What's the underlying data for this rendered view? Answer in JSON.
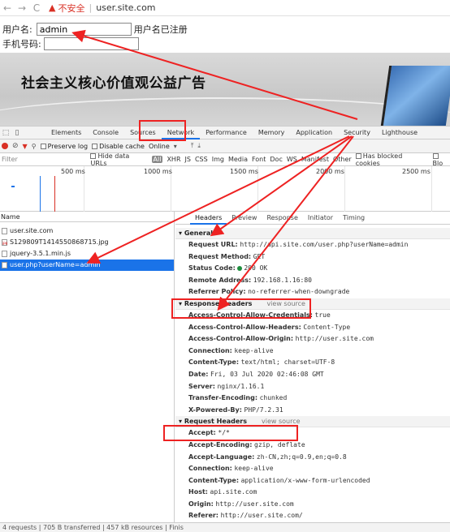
{
  "browser": {
    "back": "←",
    "forward": "→",
    "reload": "C",
    "insecure_label": "不安全",
    "separator": "|",
    "url": "user.site.com"
  },
  "form": {
    "username_label": "用户名:",
    "username_value": "admin",
    "username_status": "用户名已注册",
    "phone_label": "手机号码:",
    "phone_value": ""
  },
  "banner": {
    "text": "社会主义核心价值观公益广告"
  },
  "devtools": {
    "tabs": [
      "Elements",
      "Console",
      "Sources",
      "Network",
      "Performance",
      "Memory",
      "Application",
      "Security",
      "Lighthouse"
    ],
    "toolbar": {
      "preserve_log": "Preserve log",
      "disable_cache": "Disable cache",
      "throttle": "Online"
    },
    "filter": {
      "placeholder": "Filter",
      "hide_data_urls": "Hide data URLs",
      "types": [
        "All",
        "XHR",
        "JS",
        "CSS",
        "Img",
        "Media",
        "Font",
        "Doc",
        "WS",
        "Manifest",
        "Other"
      ],
      "has_blocked": "Has blocked cookies",
      "blocked_requests": "Blo"
    },
    "timeline_ticks": [
      "500 ms",
      "1000 ms",
      "1500 ms",
      "2000 ms",
      "2500 ms"
    ],
    "requests": {
      "header": "Name",
      "items": [
        "user.site.com",
        "S129809T1414550868715.jpg",
        "jquery-3.5.1.min.js",
        "user.php?userName=admin"
      ],
      "selected": "user.php?userName=admin"
    },
    "status_bar": "4 requests | 705 B transferred | 457 kB resources | Finis",
    "detail": {
      "tabs": [
        "Headers",
        "Preview",
        "Response",
        "Initiator",
        "Timing"
      ],
      "general": {
        "title": "General",
        "rows": [
          {
            "k": "Request URL:",
            "v": "http://api.site.com/user.php?userName=admin"
          },
          {
            "k": "Request Method:",
            "v": "GET"
          },
          {
            "k": "Status Code:",
            "v": "200 OK"
          },
          {
            "k": "Remote Address:",
            "v": "192.168.1.16:80"
          },
          {
            "k": "Referrer Policy:",
            "v": "no-referrer-when-downgrade"
          }
        ]
      },
      "response": {
        "title": "Response Headers",
        "view_source": "view source",
        "rows": [
          {
            "k": "Access-Control-Allow-Credentials:",
            "v": "true"
          },
          {
            "k": "Access-Control-Allow-Headers:",
            "v": "Content-Type"
          },
          {
            "k": "Access-Control-Allow-Origin:",
            "v": "http://user.site.com"
          },
          {
            "k": "Connection:",
            "v": "keep-alive"
          },
          {
            "k": "Content-Type:",
            "v": "text/html; charset=UTF-8"
          },
          {
            "k": "Date:",
            "v": "Fri, 03 Jul 2020 02:46:08 GMT"
          },
          {
            "k": "Server:",
            "v": "nginx/1.16.1"
          },
          {
            "k": "Transfer-Encoding:",
            "v": "chunked"
          },
          {
            "k": "X-Powered-By:",
            "v": "PHP/7.2.31"
          }
        ]
      },
      "request": {
        "title": "Request Headers",
        "view_source": "view source",
        "rows": [
          {
            "k": "Accept:",
            "v": "*/*"
          },
          {
            "k": "Accept-Encoding:",
            "v": "gzip, deflate"
          },
          {
            "k": "Accept-Language:",
            "v": "zh-CN,zh;q=0.9,en;q=0.8"
          },
          {
            "k": "Connection:",
            "v": "keep-alive"
          },
          {
            "k": "Content-Type:",
            "v": "application/x-www-form-urlencoded"
          },
          {
            "k": "Host:",
            "v": "api.site.com"
          },
          {
            "k": "Origin:",
            "v": "http://user.site.com"
          },
          {
            "k": "Referer:",
            "v": "http://user.site.com/"
          }
        ]
      }
    }
  },
  "colors": {
    "accent": "#1a73e8",
    "annotation": "#e22222",
    "insecure": "#d93025"
  }
}
